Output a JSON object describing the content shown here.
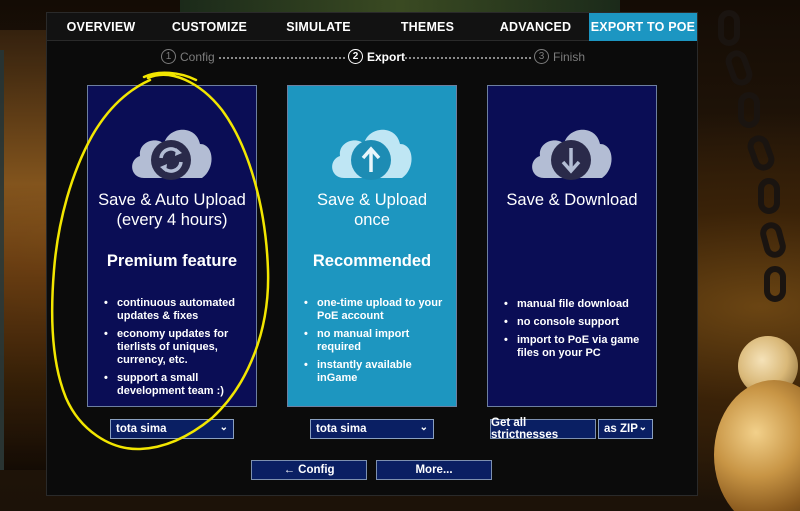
{
  "tabs": [
    {
      "label": "OVERVIEW"
    },
    {
      "label": "CUSTOMIZE"
    },
    {
      "label": "SIMULATE"
    },
    {
      "label": "THEMES"
    },
    {
      "label": "ADVANCED"
    },
    {
      "label": "EXPORT TO POE",
      "active": true
    }
  ],
  "steps": [
    {
      "num": "1",
      "label": "Config"
    },
    {
      "num": "2",
      "label": "Export",
      "current": true
    },
    {
      "num": "3",
      "label": "Finish"
    }
  ],
  "cards": [
    {
      "icon": "sync-icon",
      "title_line1": "Save & Auto Upload",
      "title_line2": "(every 4 hours)",
      "subtitle": "Premium feature",
      "features": [
        "continuous automated updates & fixes",
        "economy updates for tierlists of uniques, currency, etc.",
        "support a small development team :)"
      ],
      "select": "tota sima"
    },
    {
      "icon": "upload-icon",
      "title_line1": "Save & Upload",
      "title_line2": "once",
      "subtitle": "Recommended",
      "features": [
        "one-time upload to your PoE account",
        "no manual import required",
        "instantly available inGame"
      ],
      "select": "tota sima"
    },
    {
      "icon": "download-icon",
      "title_line1": "Save & Download",
      "title_line2": "",
      "subtitle": "",
      "features": [
        "manual file download",
        "no console support",
        "import to PoE via game files on your PC"
      ],
      "strictness_button": "Get all strictnesses",
      "format_select": "as ZIP"
    }
  ],
  "nav": {
    "back_label": "← Config",
    "more_label": "More..."
  },
  "colors": {
    "active_tab": "#1c96c2",
    "card_dark": "#0a0d55",
    "card_blue": "#1d96c0",
    "control": "#0a1f63",
    "annotation": "#f2e600"
  }
}
